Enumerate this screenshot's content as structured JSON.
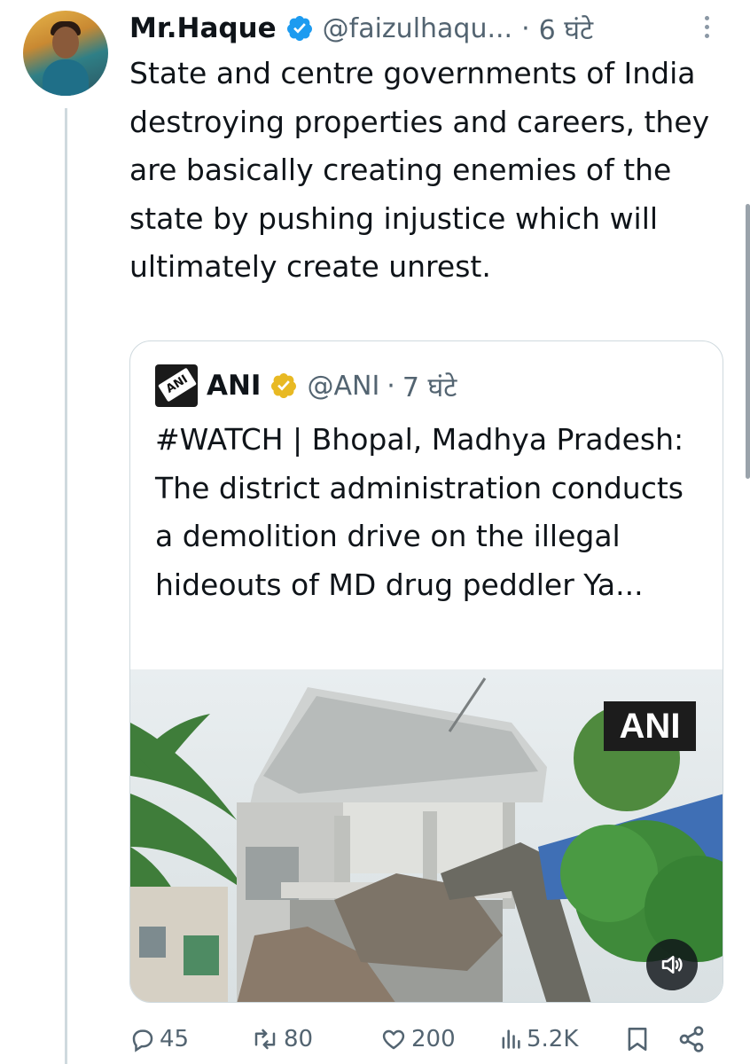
{
  "tweet": {
    "author_name": "Mr.Haque",
    "handle": "@faizulhaqu...",
    "separator": "·",
    "time": "6 घंटे",
    "text": "State and centre governments of India destroying properties and careers, they are basically creating enemies of the state by pushing injustice which will ultimately create unrest."
  },
  "quoted": {
    "author_name": "ANI",
    "logo_text": "ANI",
    "handle": "@ANI",
    "separator": "·",
    "time": "7 घंटे",
    "text": "#WATCH | Bhopal, Madhya Pradesh: The district administration conducts a demolition drive on the illegal hideouts of MD drug peddler Ya...",
    "media_watermark": "ANI",
    "media_icon": "volume-icon"
  },
  "actions": {
    "replies": "45",
    "reposts": "80",
    "likes": "200",
    "views": "5.2K"
  },
  "colors": {
    "text": "#0f1419",
    "secondary": "#536471",
    "verified_blue": "#1d9bf0",
    "verified_gold": "#e8b923",
    "border": "#cfd9de"
  }
}
